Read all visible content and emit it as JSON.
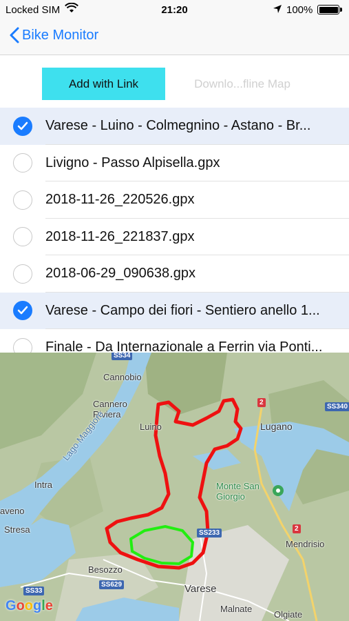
{
  "status_bar": {
    "carrier": "Locked SIM",
    "time": "21:20",
    "battery_pct": "100%"
  },
  "nav": {
    "back_label": "Bike Monitor"
  },
  "toolbar": {
    "add_label": "Add with Link",
    "download_label": "Downlo...fline Map"
  },
  "tracks": [
    {
      "name": "Varese - Luino - Colmegnino - Astano - Br...",
      "selected": true
    },
    {
      "name": "Livigno - Passo Alpisella.gpx",
      "selected": false
    },
    {
      "name": "2018-11-26_220526.gpx",
      "selected": false
    },
    {
      "name": "2018-11-26_221837.gpx",
      "selected": false
    },
    {
      "name": "2018-06-29_090638.gpx",
      "selected": false
    },
    {
      "name": "Varese - Campo dei fiori - Sentiero anello 1...",
      "selected": true
    },
    {
      "name": "Finale - Da Internazionale a Ferrin via Ponti...",
      "selected": false
    }
  ],
  "map": {
    "places": [
      "Cannobio",
      "Cannero Riviera",
      "Luino",
      "Lugano",
      "Lago Maggiore",
      "Intra",
      "Monte San Giorgio",
      "aveno",
      "Stresa",
      "Besozzo",
      "Varese",
      "Mendrisio",
      "Malnate",
      "Olgiate"
    ],
    "roads": [
      "SS34",
      "2",
      "SS340",
      "SS233",
      "2",
      "SS629",
      "SS33"
    ],
    "attribution": "Google",
    "track_colors": {
      "route1": "#ee1111",
      "route2": "#22ee11"
    }
  }
}
